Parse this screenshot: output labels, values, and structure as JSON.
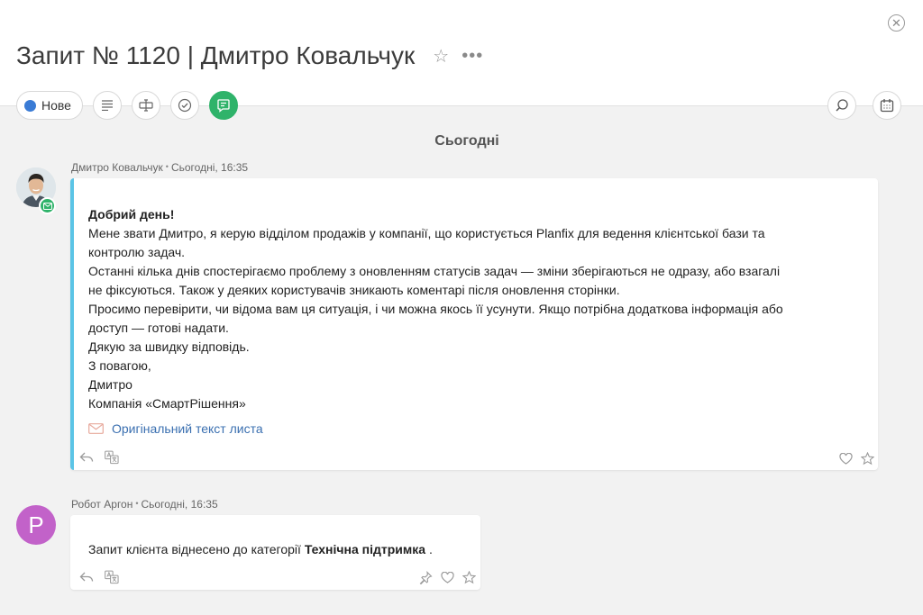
{
  "header": {
    "title": "Запит № 1120 | Дмитро Ковальчук",
    "status_label": "Нове",
    "status_color": "#3a7bd5",
    "accent_color": "#2fb36a"
  },
  "feed": {
    "date_separator": "Сьогодні",
    "messages": [
      {
        "author": "Дмитро Ковальчук",
        "time": "Сьогодні, 16:35",
        "greeting": "Добрий день!",
        "lines": [
          "Мене звати Дмитро, я керую відділом продажів у компанії, що користується Planfix для ведення клієнтської бази та",
          "контролю задач.",
          "Останні кілька днів спостерігаємо проблему з оновленням статусів задач — зміни зберігаються не одразу, або взагалі",
          "не фіксуються. Також у деяких користувачів зникають коментарі після оновлення сторінки.",
          "Просимо перевірити, чи відома вам ця ситуація, і чи можна якось її усунути. Якщо потрібна додаткова інформація або",
          "доступ — готові надати.",
          "Дякую за швидку відповідь.",
          "З повагою,",
          "Дмитро",
          "Компанія «СмартРішення»"
        ],
        "original_link": "Оригінальний текст листа"
      },
      {
        "author": "Робот Аргон",
        "time": "Сьогодні, 16:35",
        "avatar_letter": "Р",
        "text_before": "Запит клієнта віднесено до категорії",
        "text_bold": "Технічна підтримка",
        "text_after": " ."
      }
    ]
  }
}
